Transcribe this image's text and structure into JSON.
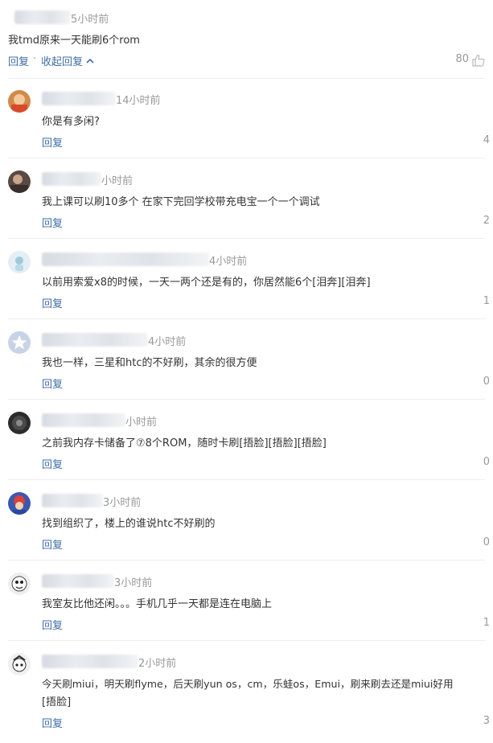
{
  "main_comment": {
    "time": "5小时前",
    "content": "我tmd原来一天能刷6个rom",
    "reply_label": "回复",
    "dot": "·",
    "collapse_label": "收起回复",
    "collapse_icon": "chevron-up-icon",
    "like_count": "80",
    "like_icon": "thumb-up-icon"
  },
  "replies": [
    {
      "time": "14小时前",
      "content": "你是有多闲?",
      "reply_label": "回复",
      "count": "4",
      "avatar_color": "#c47a3a"
    },
    {
      "time": "小时前",
      "content": "我上课可以刷10多个 在家下完回学校带充电宝一个一个调试",
      "reply_label": "回复",
      "count": "2",
      "avatar_color": "#5a4a45"
    },
    {
      "time": "4小时前",
      "content": "以前用索爱x8的时候，一天一两个还是有的，你居然能6个[泪奔][泪奔]",
      "reply_label": "回复",
      "count": "1",
      "avatar_color": "#e4eef4"
    },
    {
      "time": "4小时前",
      "content": "我也一样，三星和htc的不好刷，其余的很方便",
      "reply_label": "回复",
      "count": "0",
      "avatar_color": "#c9d3e6"
    },
    {
      "time": "小时前",
      "content": "之前我内存卡储备了⑦8个ROM，随时卡刷[捂脸][捂脸][捂脸]",
      "reply_label": "回复",
      "count": "0",
      "avatar_color": "#2c2c2c"
    },
    {
      "time": "3小时前",
      "content": "找到组织了，楼上的谁说htc不好刷的",
      "reply_label": "回复",
      "count": "0",
      "avatar_color": "#d94040"
    },
    {
      "time": "3小时前",
      "content": "我室友比他还闲。。。手机几乎一天都是连在电脑上",
      "reply_label": "回复",
      "count": "1",
      "avatar_color": "#eeeeee"
    },
    {
      "time": "2小时前",
      "content": "今天刷miui，明天刷flyme，后天刷yun os，cm，乐蛙os，Emui，刷来刷去还是miui好用",
      "content_line2": "[捂脸]",
      "reply_label": "回复",
      "count": "3",
      "avatar_color": "#f0f0f0"
    }
  ]
}
